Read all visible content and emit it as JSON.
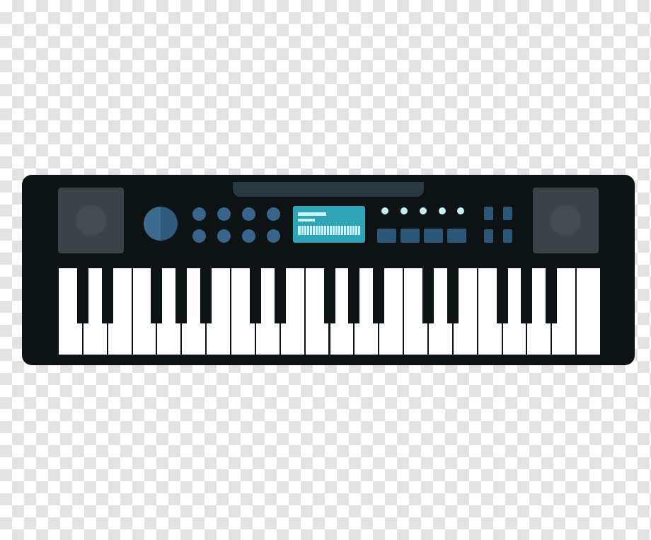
{
  "image": {
    "subject": "keyboard-synthesizer",
    "background": "transparency-checkerboard",
    "colors": {
      "body": "#0d1214",
      "speaker": "#3b4348",
      "knob": "#3a648a",
      "screen": "#2fa4b6",
      "screen_detail": "#c8f2f6",
      "led": "#c8eef2",
      "pad": "#2c5676",
      "white_key": "#ffffff",
      "black_key": "#0d1214"
    },
    "controls": {
      "speakers": 2,
      "volume_knobs": 1,
      "small_knobs": 8,
      "lcd_screens": 1,
      "leds": 5,
      "pads": 4,
      "square_buttons": 4
    },
    "keys": {
      "white": 22,
      "black": 15
    }
  }
}
